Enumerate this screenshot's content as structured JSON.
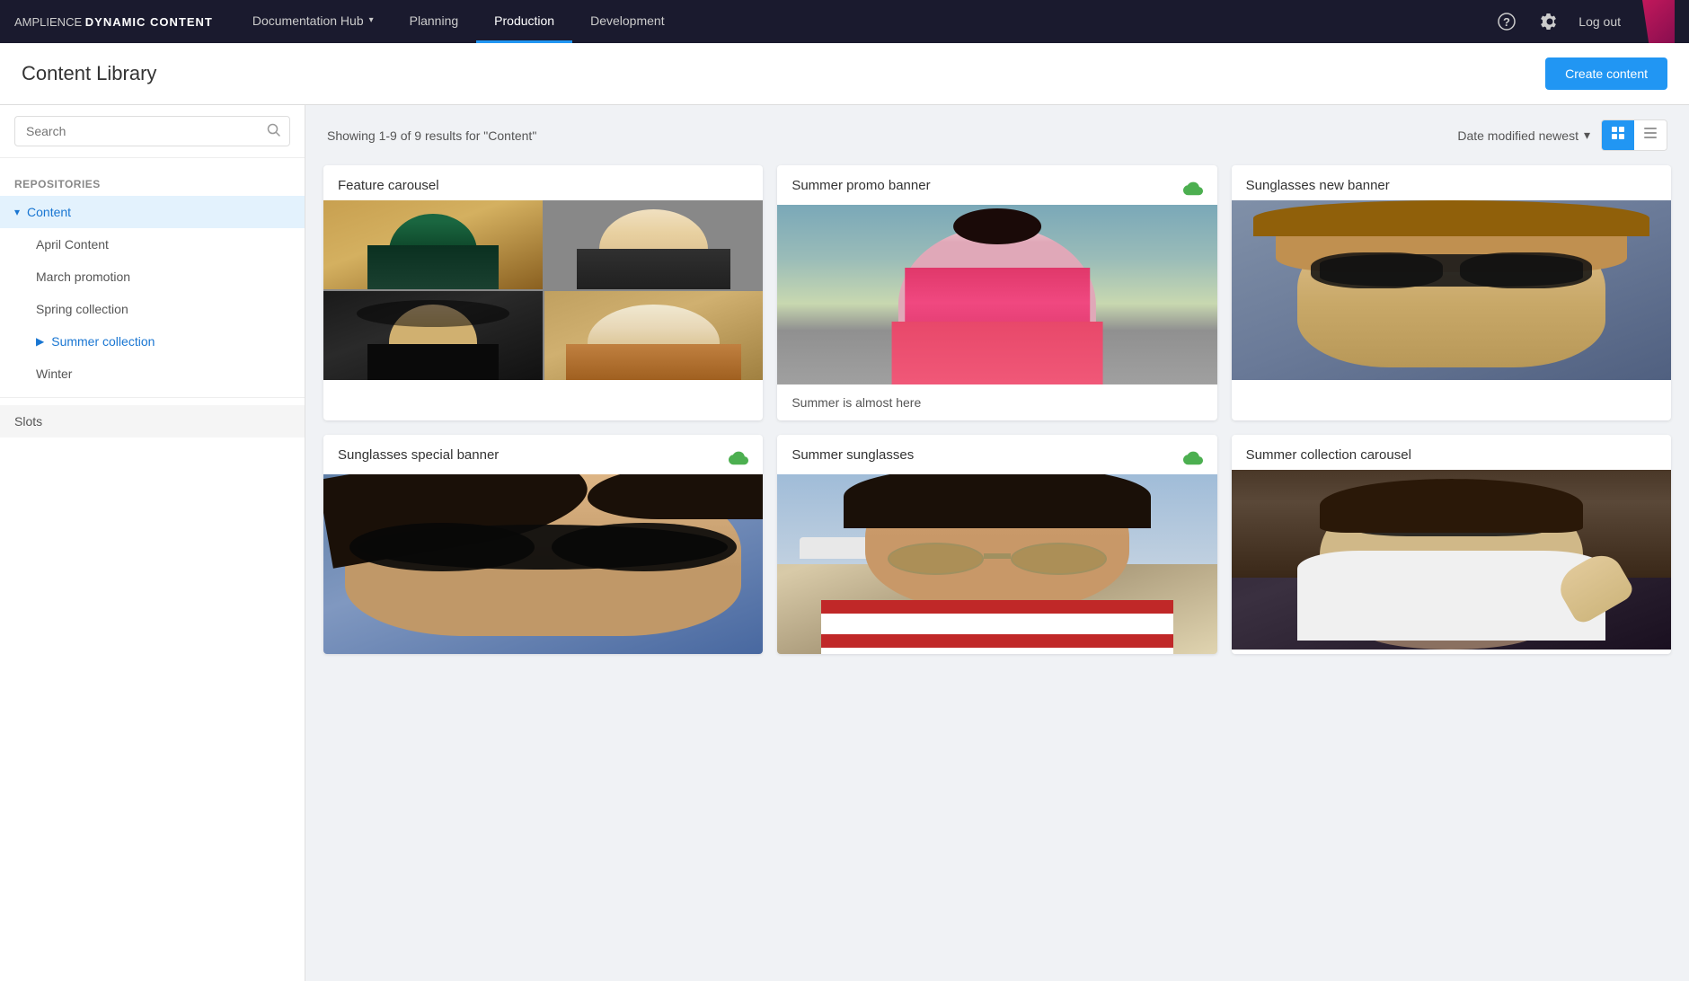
{
  "brand": {
    "amplience": "AMPLIENCE",
    "product": "DYNAMIC CONTENT"
  },
  "nav": {
    "tabs": [
      {
        "id": "documentation-hub",
        "label": "Documentation Hub",
        "has_dropdown": true,
        "active": false
      },
      {
        "id": "planning",
        "label": "Planning",
        "has_dropdown": false,
        "active": false
      },
      {
        "id": "production",
        "label": "Production",
        "has_dropdown": false,
        "active": true
      },
      {
        "id": "development",
        "label": "Development",
        "has_dropdown": false,
        "active": false
      }
    ],
    "logout": "Log out"
  },
  "page": {
    "title": "Content Library",
    "create_button": "Create content"
  },
  "sidebar": {
    "search_placeholder": "Search",
    "repositories_label": "Repositories",
    "items": [
      {
        "id": "content",
        "label": "Content",
        "expanded": true,
        "active_parent": true
      },
      {
        "id": "april-content",
        "label": "April Content",
        "level": "child"
      },
      {
        "id": "march-promotion",
        "label": "March promotion",
        "level": "child"
      },
      {
        "id": "spring-collection",
        "label": "Spring collection",
        "level": "child"
      },
      {
        "id": "summer-collection",
        "label": "Summer collection",
        "level": "child",
        "selected": true
      },
      {
        "id": "winter",
        "label": "Winter",
        "level": "child"
      }
    ],
    "slots": {
      "label": "Slots"
    }
  },
  "content": {
    "results_text": "Showing 1-9 of 9 results for \"Content\"",
    "sort_label": "Date modified newest",
    "cards": [
      {
        "id": "feature-carousel",
        "title": "Feature carousel",
        "has_status": false,
        "type": "carousel"
      },
      {
        "id": "summer-promo-banner",
        "title": "Summer promo banner",
        "has_status": true,
        "status_type": "cloud",
        "subtitle": "Summer is almost here",
        "type": "banner"
      },
      {
        "id": "sunglasses-new-banner",
        "title": "Sunglasses new banner",
        "has_status": false,
        "type": "sunglasses"
      },
      {
        "id": "sunglasses-special-banner",
        "title": "Sunglasses special banner",
        "has_status": true,
        "status_type": "check-cloud",
        "type": "sunglasses-special"
      },
      {
        "id": "summer-sunglasses",
        "title": "Summer sunglasses",
        "has_status": true,
        "status_type": "check-cloud",
        "type": "summer-sunglasses"
      },
      {
        "id": "summer-collection-carousel",
        "title": "Summer collection carousel",
        "has_status": false,
        "type": "collection-carousel"
      }
    ]
  }
}
